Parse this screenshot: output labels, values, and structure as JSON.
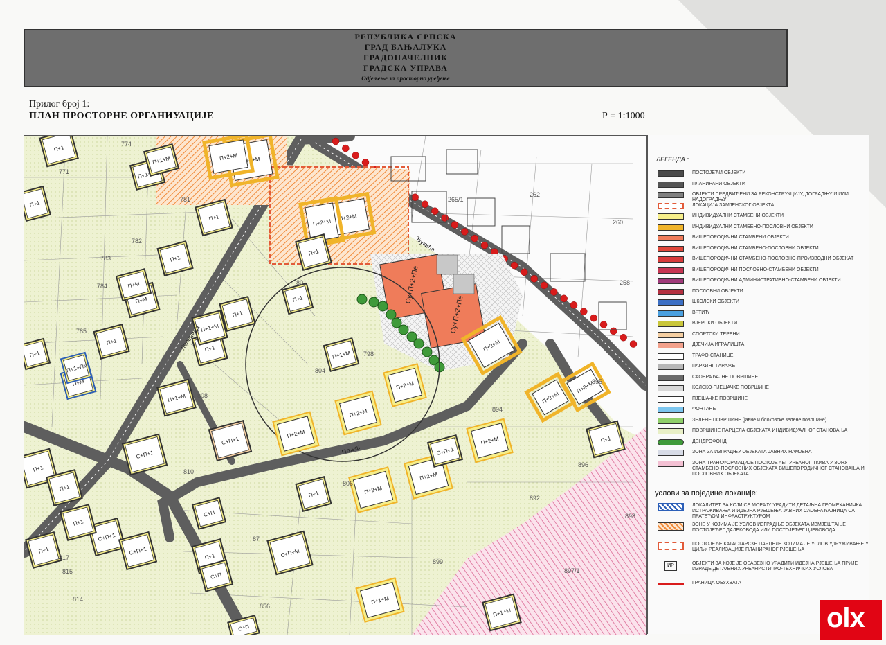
{
  "header": {
    "line1": "РЕПУБЛИКА СРПСКА",
    "line2": "ГРАД БАЊАЛУКА",
    "line3": "ГРАДОНАЧЕЛНИК",
    "line4": "ГРАДСКА УПРАВА",
    "department": "Одјељење за просторно уређење"
  },
  "sheet": {
    "attachment": "Прилог број 1:",
    "title": "ПЛАН ПРОСТОРНЕ ОРГАНИУАЦИЈЕ",
    "scale": "Р = 1:1000"
  },
  "map": {
    "street_labels": [
      "Лепеница",
      "Ђукића",
      "Пљеш"
    ],
    "parcel_numbers": [
      "774",
      "771",
      "781",
      "782",
      "783",
      "784",
      "785",
      "801",
      "804",
      "798",
      "808",
      "810",
      "806",
      "814",
      "815",
      "817",
      "262",
      "260",
      "258",
      "265/1",
      "894",
      "895",
      "896",
      "892",
      "899",
      "898",
      "897/1",
      "856",
      "87"
    ],
    "buildings": [
      {
        "label": "П+2+М"
      },
      {
        "label": "П+2+М"
      },
      {
        "label": "П+2+М"
      },
      {
        "label": "П+2+М"
      },
      {
        "label": "Су+П+2+Пе"
      },
      {
        "label": "Су+П+2+Пе"
      },
      {
        "label": "П+2+М"
      },
      {
        "label": "П+2+М"
      },
      {
        "label": "П+2+М"
      },
      {
        "label": "П+2+М"
      },
      {
        "label": "П+2+М"
      },
      {
        "label": "П+2+М"
      },
      {
        "label": "П+2+М"
      },
      {
        "label": "П+2+М"
      },
      {
        "label": "П+2+М"
      },
      {
        "label": "П+1+М"
      },
      {
        "label": "П+1+М"
      },
      {
        "label": "П+1"
      },
      {
        "label": "П+1"
      },
      {
        "label": "П+1"
      },
      {
        "label": "П+1"
      },
      {
        "label": "П+1"
      },
      {
        "label": "П+1"
      },
      {
        "label": "П+1"
      },
      {
        "label": "П+1"
      },
      {
        "label": "П+1+М"
      },
      {
        "label": "П+М"
      },
      {
        "label": "П+М"
      },
      {
        "label": "П+М"
      },
      {
        "label": "П+1+М"
      },
      {
        "label": "С+П+1"
      },
      {
        "label": "С+П+1"
      },
      {
        "label": "С+П+1"
      },
      {
        "label": "С+П+1"
      },
      {
        "label": "С+П+М"
      },
      {
        "label": "С+П"
      },
      {
        "label": "С+П"
      },
      {
        "label": "П+1+Пк"
      },
      {
        "label": "П+1+М"
      },
      {
        "label": "П+1"
      },
      {
        "label": "П+1"
      },
      {
        "label": "П+1"
      },
      {
        "label": "П+1"
      },
      {
        "label": "П+1"
      },
      {
        "label": "П+1"
      },
      {
        "label": "П+1"
      },
      {
        "label": "П+1+Пк"
      },
      {
        "label": "П+1+М"
      },
      {
        "label": "П+1"
      },
      {
        "label": "П+1"
      },
      {
        "label": "С+П+1"
      },
      {
        "label": "С+П"
      },
      {
        "label": "П+1+М"
      }
    ]
  },
  "legend": {
    "title": "ЛЕГЕНДА :",
    "items": [
      {
        "label": "ПОСТОЈЕЋИ ОБЈЕКТИ",
        "color": "#4a4a4a"
      },
      {
        "label": "ПЛАНИРАНИ ОБЈЕКТИ",
        "color": "#555555"
      },
      {
        "label": "ОБЈЕКТИ ПРЕДВИЂЕНИ ЗА РЕКОНСТРУКЦИЈУ, ДОГРАДЊУ И ИЛИ НАДОГРАДЊУ",
        "color": "#808080"
      },
      {
        "label": "ЛОКАЦИЈА ЗАМЈЕНСКОГ ОБЈЕКТА",
        "color": "#ffffff"
      },
      {
        "label": "ИНДИВИДУАЛНИ СТАМБЕНИ ОБЈЕКТИ",
        "color": "#f6ee8a"
      },
      {
        "label": "ИНДИВИДУАЛНИ СТАМБЕНО-ПОСЛОВНИ ОБЈЕКТИ",
        "color": "#f0b42a"
      },
      {
        "label": "ВИШЕПОРОДИЧНИ СТАМБЕНИ ОБЈЕКТИ",
        "color": "#ef7c5a"
      },
      {
        "label": "ВИШЕПОРОДИЧНИ СТАМБЕНО-ПОСЛОВНИ ОБЈЕКТИ",
        "color": "#e0473a"
      },
      {
        "label": "ВИШЕПОРОДИЧНИ СТАМБЕНО-ПОСЛОВНО-ПРОИЗВОДНИ ОБЈЕКАТ",
        "color": "#d63b3b"
      },
      {
        "label": "ВИШЕПОРОДИЧНИ ПОСЛОВНО-СТАМБЕНИ ОБЈЕКТИ",
        "color": "#c63552"
      },
      {
        "label": "ВИШЕПОРОДИЧНИ АДМИНИСТРАТИВНО-СТАМБЕНИ ОБЈЕКТИ",
        "color": "#a03a7a"
      },
      {
        "label": "ПОСЛОВНИ ОБЈЕКТИ",
        "color": "#b33040"
      },
      {
        "label": "ШКОЛСКИ ОБЈЕКТИ",
        "color": "#3c6fc4"
      },
      {
        "label": "ВРТИЋ",
        "color": "#4aa0e0"
      },
      {
        "label": "ВЈЕРСКИ ОБЈЕКТИ",
        "color": "#c9c63a"
      },
      {
        "label": "СПОРТСКИ ТЕРЕНИ",
        "color": "#f5cfa2"
      },
      {
        "label": "ДЈЕЧИЈА ИГРАЛИШТА",
        "color": "#f2a18c"
      },
      {
        "label": "ТРАФО-СТАНИЦЕ",
        "color": "#ffffff"
      },
      {
        "label": "ПАРКИНГ ГАРАЖЕ",
        "color": "#b8b8b8"
      },
      {
        "label": "САОБРАЋАЈНЕ ПОВРШИНЕ",
        "color": "#6a6a6a"
      },
      {
        "label": "КОЛСКО-ПЈЕШАЧКЕ ПОВРШИНЕ",
        "color": "#d8d8d8"
      },
      {
        "label": "ПЈЕШАЧКЕ ПОВРШИНЕ",
        "color": "#ffffff"
      },
      {
        "label": "ФОНТАНЕ",
        "color": "#7cc6ef"
      },
      {
        "label": "ЗЕЛЕНЕ ПОВРШИНЕ (јавне и блоковске зелене површине)",
        "color": "#8fcf6a"
      },
      {
        "label": "ПОВРШИНЕ ПАРЦЕЛА ОБЈЕКАТА ИНДИВИДУАЛНОГ СТАНОВАЊА",
        "color": "#e8efc6"
      },
      {
        "label": "ДЕНДРОФОНД",
        "color": "#3f9a3a"
      },
      {
        "label": "ЗОНА ЗА ИЗГРАДЊУ ОБЈЕКАТА ЈАВНИХ НАМЈЕНА",
        "color": "#d7dbe6"
      },
      {
        "label": "ЗОНА ТРАНСФОРМАЦИЈЕ ПОСТОЈЕЋЕГ УРБАНОГ ТКИВА У ЗОНУ СТАМБЕНО-ПОСЛОВНИХ ОБЈЕКАТА ВИШЕПОРОДИЧНОГ СТАНОВАЊА И ПОСЛОВНИХ ОБЈЕКАТА",
        "color": "#f3c0d3"
      }
    ]
  },
  "conditions": {
    "title": "услови за поједине локације:",
    "items": [
      {
        "label": "ЛОКАЛИТЕТ ЗА КОЈИ СЕ МОРАЈУ УРАДИТИ ДЕТАЉНА ГЕОМЕХАНИЧКА ИСТРАЖИВАЊА И ИДЕЈНА РЈЕШЕЊА ЈАВНИХ САОБРАЋАЈНИЦА СА ПРАТЕЋОМ ИНФРАСТРУКТУРОМ",
        "color": "#2c5fb8"
      },
      {
        "label": "ЗОНЕ У КОЈИМА ЈЕ УСЛОВ ИЗГРАДЊЕ ОБЈЕКАТА ИЗМЈЕШТАЊЕ ПОСТОЈЕЋЕГ ДАЛЕКОВОДА ИЛИ ПОСТОЈЕЋЕГ ЦЈЕВОВОДА",
        "color": "#f08a3a"
      },
      {
        "label": "ПОСТОЈЕЋЕ КАТАСТАРСКЕ ПАРЦЕЛЕ КОЈИМА ЈЕ УСЛОВ УДРУЖИВАЊЕ У ЦИЉУ РЕАЛИЗАЦИЈЕ ПЛАНИРАНОГ РЈЕШЕЊА",
        "color": "#e25b3a"
      },
      {
        "label": "ОБЈЕКТИ ЗА КОЈЕ ЈЕ ОБАВЕЗНО УРАДИТИ ИДЕЈНА РЈЕШЕЊА ПРИЈЕ ИЗРАДЕ ДЕТАЉНИХ УРБАНИСТИЧКО-ТЕХНИЧКИХ УСЛОВА",
        "color": "#ffffff"
      },
      {
        "label": "ГРАНИЦА ОБУХВАТА",
        "color": "#d91c1c"
      }
    ],
    "ir_badge": "ИР"
  },
  "watermark": "olx"
}
